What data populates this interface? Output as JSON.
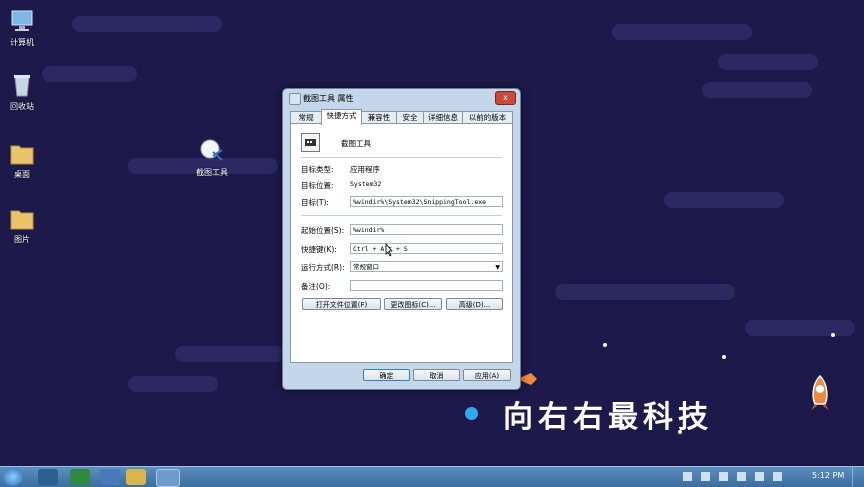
{
  "desktop": {
    "icons": [
      {
        "label": "计算机",
        "icon": "computer-icon"
      },
      {
        "label": "回收站",
        "icon": "recycle-bin-icon"
      },
      {
        "label": "桌面",
        "icon": "folder-icon"
      },
      {
        "label": "图片",
        "icon": "folder-icon"
      },
      {
        "label": "截图工具",
        "icon": "snipping-tool-icon"
      }
    ],
    "watermark": "向右右最科技"
  },
  "dialog": {
    "title": "截图工具 属性",
    "close_symbol": "x",
    "tabs": [
      "常规",
      "快捷方式",
      "兼容性",
      "安全",
      "详细信息",
      "以前的版本"
    ],
    "active_tab": "快捷方式",
    "app_name": "截图工具",
    "fields": {
      "target_type_label": "目标类型:",
      "target_type_value": "应用程序",
      "target_location_label": "目标位置:",
      "target_location_value": "System32",
      "target_label": "目标(T):",
      "target_value": "%windir%\\System32\\SnippingTool.exe",
      "start_in_label": "起始位置(S):",
      "start_in_value": "%windir%",
      "shortcut_key_label": "快捷键(K):",
      "shortcut_key_value": "Ctrl + Alt + S",
      "run_label": "运行方式(R):",
      "run_value": "常规窗口",
      "comment_label": "备注(O):",
      "comment_value": ""
    },
    "buttons": {
      "open_location": "打开文件位置(F)",
      "change_icon": "更改图标(C)...",
      "advanced": "高级(D)...",
      "ok": "确定",
      "cancel": "取消",
      "apply": "应用(A)"
    }
  },
  "taskbar": {
    "clock": "5:12 PM"
  }
}
